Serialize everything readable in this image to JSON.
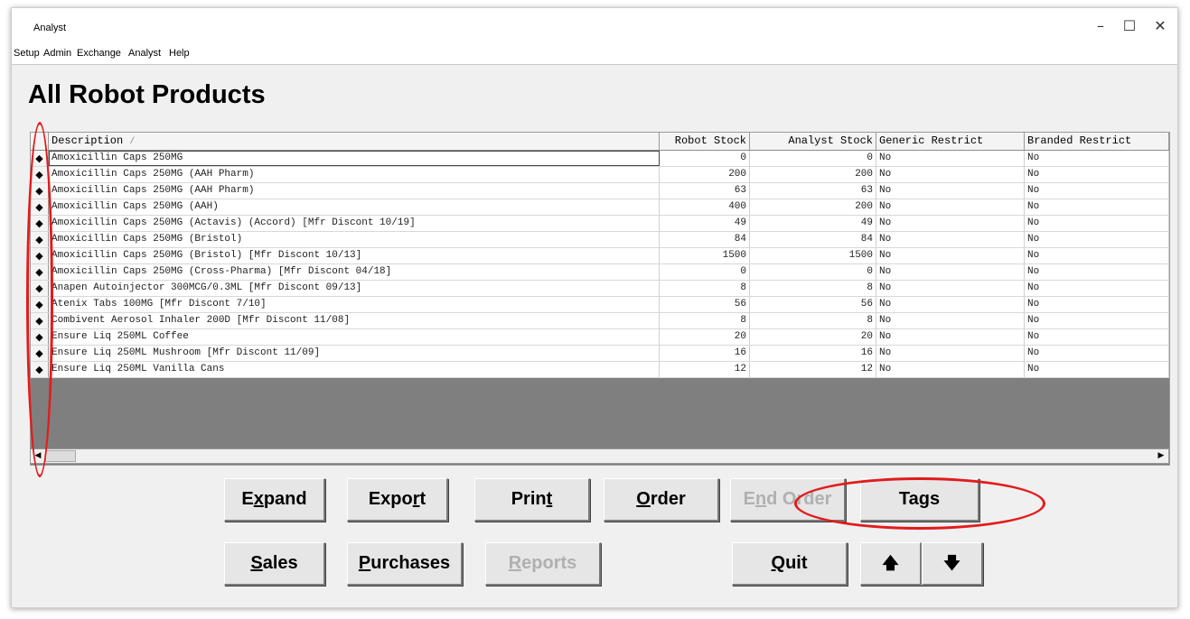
{
  "window": {
    "title": "Analyst",
    "minimize_glyph": "–",
    "maximize_glyph": "☐",
    "close_glyph": "✕"
  },
  "menu": [
    "Setup",
    "Admin",
    "Exchange",
    "Analyst",
    "Help"
  ],
  "page_title": "All Robot Products",
  "grid": {
    "columns": [
      "Description",
      "Robot Stock",
      "Analyst Stock",
      "Generic Restrict",
      "Branded Restrict"
    ],
    "sort_indicator": "/",
    "rows": [
      {
        "description": "Amoxicillin Caps 250MG",
        "robot_stock": "0",
        "analyst_stock": "0",
        "generic_restrict": "No",
        "branded_restrict": "No"
      },
      {
        "description": "Amoxicillin Caps 250MG (AAH Pharm)",
        "robot_stock": "200",
        "analyst_stock": "200",
        "generic_restrict": "No",
        "branded_restrict": "No"
      },
      {
        "description": "Amoxicillin Caps 250MG (AAH Pharm)",
        "robot_stock": "63",
        "analyst_stock": "63",
        "generic_restrict": "No",
        "branded_restrict": "No"
      },
      {
        "description": "Amoxicillin Caps 250MG (AAH)",
        "robot_stock": "400",
        "analyst_stock": "200",
        "generic_restrict": "No",
        "branded_restrict": "No"
      },
      {
        "description": "Amoxicillin Caps 250MG (Actavis) (Accord) [Mfr Discont 10/19]",
        "robot_stock": "49",
        "analyst_stock": "49",
        "generic_restrict": "No",
        "branded_restrict": "No"
      },
      {
        "description": "Amoxicillin Caps 250MG (Bristol)",
        "robot_stock": "84",
        "analyst_stock": "84",
        "generic_restrict": "No",
        "branded_restrict": "No"
      },
      {
        "description": "Amoxicillin Caps 250MG (Bristol) [Mfr Discont 10/13]",
        "robot_stock": "1500",
        "analyst_stock": "1500",
        "generic_restrict": "No",
        "branded_restrict": "No"
      },
      {
        "description": "Amoxicillin Caps 250MG (Cross-Pharma) [Mfr Discont 04/18]",
        "robot_stock": "0",
        "analyst_stock": "0",
        "generic_restrict": "No",
        "branded_restrict": "No"
      },
      {
        "description": "Anapen Autoinjector 300MCG/0.3ML [Mfr Discont 09/13]",
        "robot_stock": "8",
        "analyst_stock": "8",
        "generic_restrict": "No",
        "branded_restrict": "No"
      },
      {
        "description": "Atenix Tabs 100MG [Mfr Discont 7/10]",
        "robot_stock": "56",
        "analyst_stock": "56",
        "generic_restrict": "No",
        "branded_restrict": "No"
      },
      {
        "description": "Combivent Aerosol Inhaler 200D  [Mfr Discont 11/08]",
        "robot_stock": "8",
        "analyst_stock": "8",
        "generic_restrict": "No",
        "branded_restrict": "No"
      },
      {
        "description": "Ensure Liq 250ML Coffee",
        "robot_stock": "20",
        "analyst_stock": "20",
        "generic_restrict": "No",
        "branded_restrict": "No"
      },
      {
        "description": "Ensure Liq 250ML Mushroom  [Mfr Discont 11/09]",
        "robot_stock": "16",
        "analyst_stock": "16",
        "generic_restrict": "No",
        "branded_restrict": "No"
      },
      {
        "description": "Ensure Liq 250ML Vanilla Cans",
        "robot_stock": "12",
        "analyst_stock": "12",
        "generic_restrict": "No",
        "branded_restrict": "No"
      }
    ],
    "row_marker": "◆",
    "scroll_left": "◀",
    "scroll_right": "▶"
  },
  "buttons": {
    "expand": "Expand",
    "export": "Export",
    "print": "Print",
    "order": "Order",
    "end_order": "End Order",
    "tags": "Tags",
    "sales": "Sales",
    "purchases": "Purchases",
    "reports": "Reports",
    "quit": "Quit",
    "up": "🡅",
    "down": "🡇"
  },
  "annotation_color": "#e21b1b"
}
